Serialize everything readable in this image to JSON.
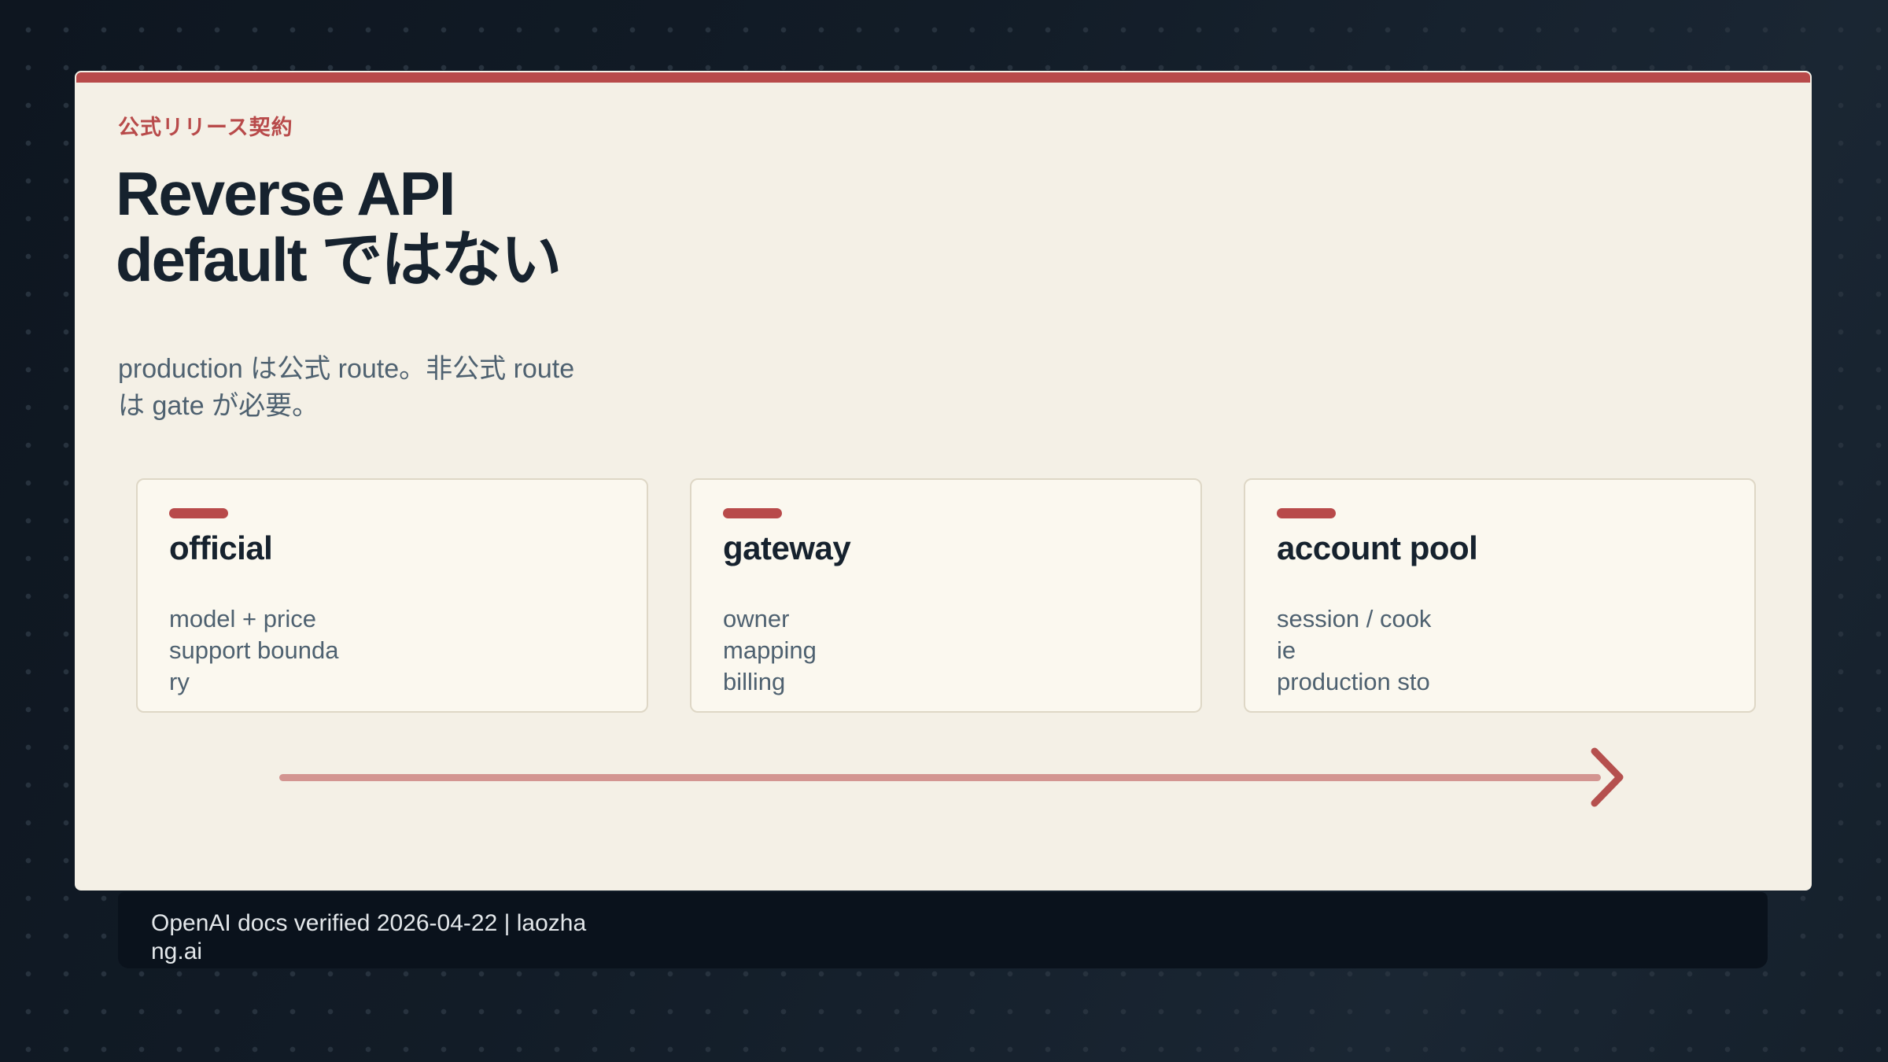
{
  "theme": {
    "page_bg": "#121c26",
    "page_bg_light": "#1b2835",
    "dot": "#27323e",
    "panel_bg": "#f4f0e6",
    "accent": "#b84a4a",
    "ink": "#16222e",
    "muted": "#4e6170",
    "card_bg": "#fbf8ef",
    "card_border": "#ded7c6",
    "footer_bg": "#0a121c",
    "footer_text": "#e3e7ea"
  },
  "slide": {
    "eyebrow": "公式リリース契約",
    "title_lines": [
      "Reverse API",
      "default ではない"
    ],
    "subtitle_lines": [
      "production は公式 route。非公式 route",
      "は gate が必要。"
    ],
    "cards": [
      {
        "title": "official",
        "body_lines": [
          "model + price",
          "support bounda",
          "ry"
        ]
      },
      {
        "title": "gateway",
        "body_lines": [
          "owner",
          "mapping",
          "billing"
        ]
      },
      {
        "title": "account pool",
        "body_lines": [
          "session / cook",
          "ie",
          "production sto"
        ]
      }
    ],
    "arrow": {
      "icon": "arrow-right"
    }
  },
  "footer": {
    "lines": [
      "OpenAI docs verified 2026-04-22 | laozha",
      "ng.ai"
    ],
    "text": "OpenAI docs verified 2026-04-22 | laozhang.ai"
  }
}
